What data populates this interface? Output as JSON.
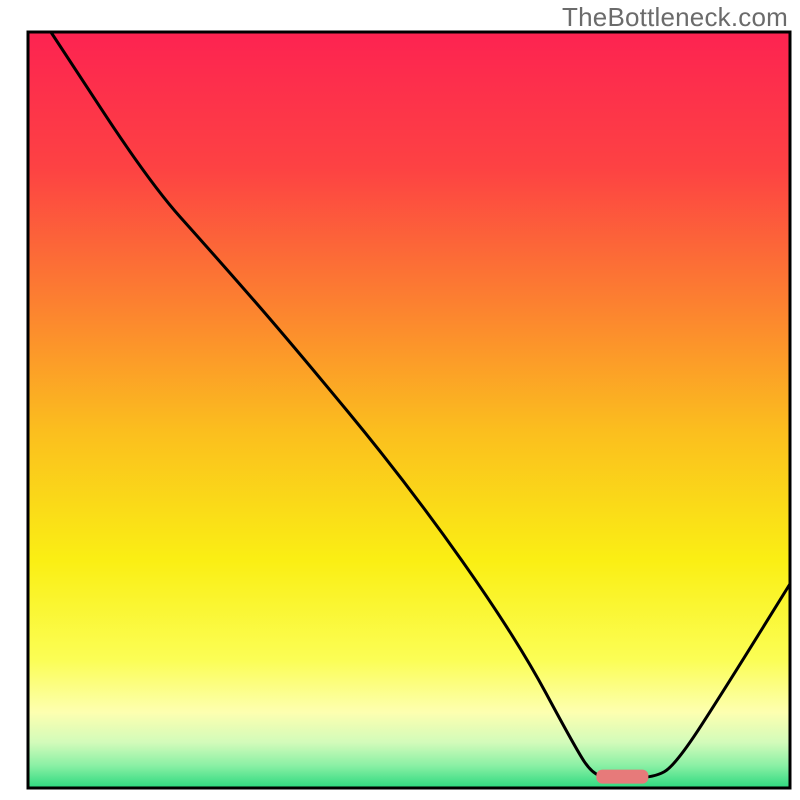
{
  "attribution": "TheBottleneck.com",
  "chart_data": {
    "type": "line",
    "title": "",
    "xlabel": "",
    "ylabel": "",
    "xlim": [
      0,
      100
    ],
    "ylim": [
      0,
      100
    ],
    "grid": false,
    "marker": {
      "x": 78,
      "y": 1.5,
      "color": "#e77a7a"
    },
    "gradient_stops": [
      {
        "offset": 0,
        "color": "#fd2351"
      },
      {
        "offset": 18,
        "color": "#fd4243"
      },
      {
        "offset": 36,
        "color": "#fc8130"
      },
      {
        "offset": 53,
        "color": "#fbbf1e"
      },
      {
        "offset": 70,
        "color": "#faef14"
      },
      {
        "offset": 83,
        "color": "#fbfe55"
      },
      {
        "offset": 90,
        "color": "#fdffb0"
      },
      {
        "offset": 94,
        "color": "#d2fbba"
      },
      {
        "offset": 97,
        "color": "#8bf0a5"
      },
      {
        "offset": 100,
        "color": "#2dd97f"
      }
    ],
    "series": [
      {
        "name": "curve",
        "points": [
          {
            "x": 3,
            "y": 100
          },
          {
            "x": 16,
            "y": 80
          },
          {
            "x": 24,
            "y": 71
          },
          {
            "x": 34,
            "y": 59.5
          },
          {
            "x": 50,
            "y": 40
          },
          {
            "x": 64,
            "y": 20
          },
          {
            "x": 72,
            "y": 5
          },
          {
            "x": 74,
            "y": 2
          },
          {
            "x": 76,
            "y": 1.3
          },
          {
            "x": 82,
            "y": 1.3
          },
          {
            "x": 85,
            "y": 3
          },
          {
            "x": 92,
            "y": 14
          },
          {
            "x": 100,
            "y": 27
          }
        ]
      }
    ]
  }
}
